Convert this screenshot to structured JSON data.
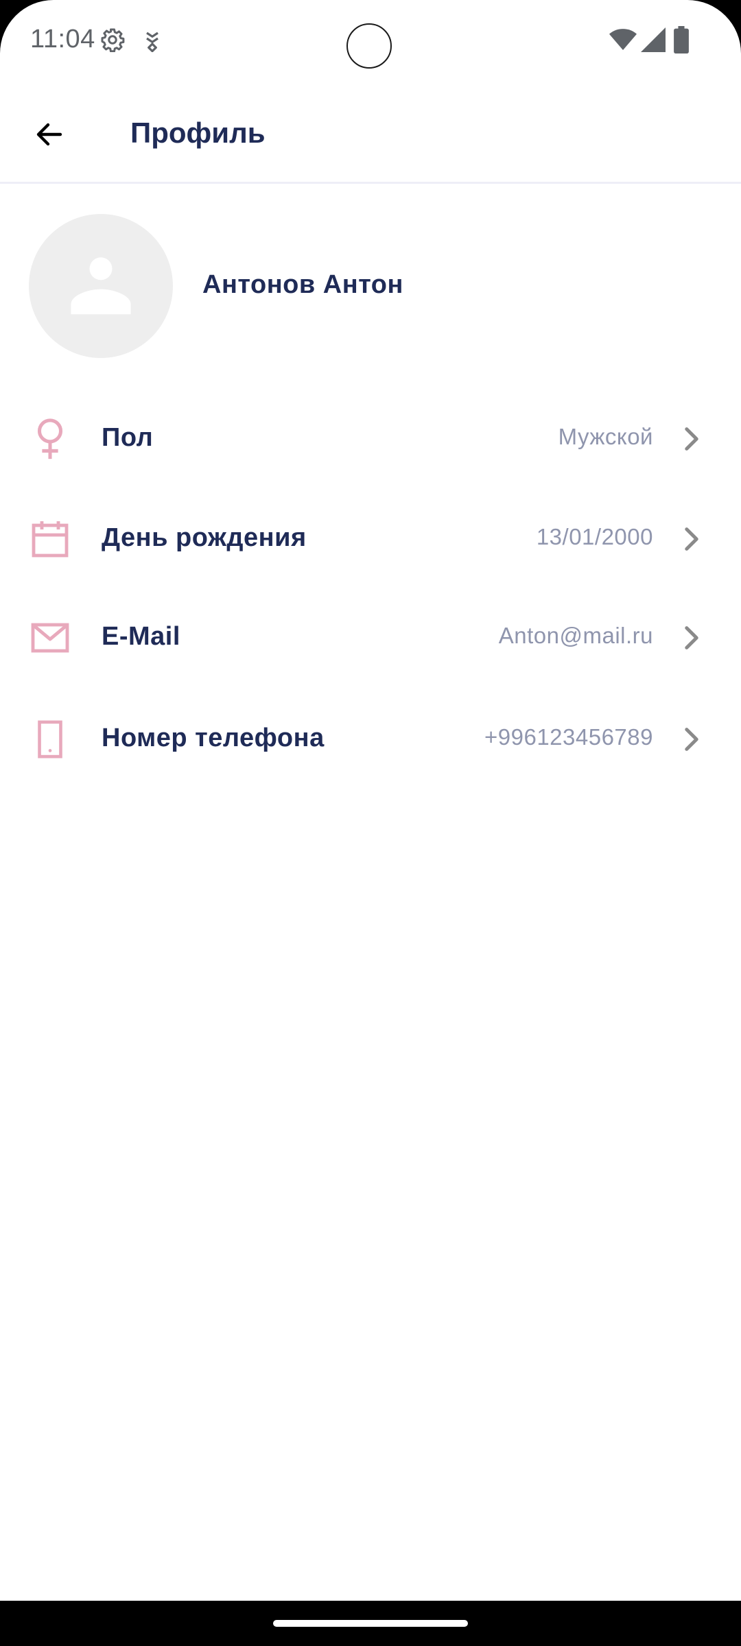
{
  "status_bar": {
    "time": "11:04",
    "icons": [
      "settings-gear-icon",
      "download-shield-icon",
      "wifi-icon",
      "cellular-signal-icon",
      "battery-icon"
    ]
  },
  "app_bar": {
    "back_icon": "arrow-left-icon",
    "title": "Профиль"
  },
  "profile": {
    "avatar_icon": "person-placeholder-icon",
    "name": "Антонов Антон"
  },
  "rows": [
    {
      "icon": "female-symbol-icon",
      "label": "Пол",
      "value": "Мужской"
    },
    {
      "icon": "calendar-icon",
      "label": "День рождения",
      "value": "13/01/2000"
    },
    {
      "icon": "envelope-icon",
      "label": "E-Mail",
      "value": "Anton@mail.ru"
    },
    {
      "icon": "phone-icon",
      "label": "Номер телефона",
      "value": "+996123456789"
    }
  ],
  "colors": {
    "accent_icon": "#e8a9bc",
    "title_text": "#1f2b57",
    "value_text": "#8f95ad",
    "chevron": "#8a8a8a",
    "divider": "#eeeef7"
  }
}
